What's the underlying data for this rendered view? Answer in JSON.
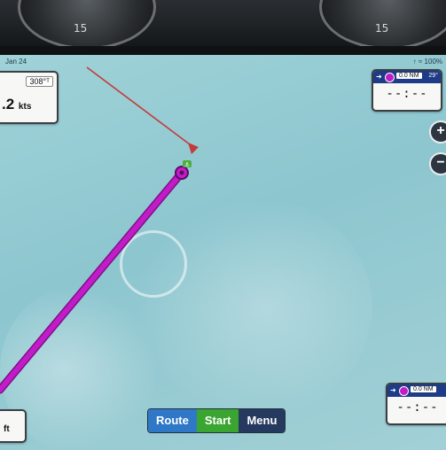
{
  "status": {
    "date": "Jan 24",
    "right": "↑ ≈ 100%"
  },
  "speed_panel": {
    "heading": "308°ᵀ",
    "value": ".2",
    "unit": "kts"
  },
  "depth_panel": {
    "unit": "ft"
  },
  "waypoint_top": {
    "distance": "0.0 NM",
    "bearing": "29°",
    "eta": "--:--"
  },
  "waypoint_bottom": {
    "distance": "0.0 NM",
    "eta": "--:--"
  },
  "zoom": {
    "in": "+",
    "out": "−"
  },
  "bottom_nav": {
    "route": "Route",
    "start": "Start",
    "menu": "Menu"
  },
  "gauges": {
    "left": "15",
    "right": "15"
  },
  "colors": {
    "route_line": "#c11cc8",
    "heading_line": "#c23b36",
    "sea": "#9fd2d8",
    "start_button": "#3aa531",
    "route_button": "#2f78c7",
    "menu_button": "#26395f"
  }
}
